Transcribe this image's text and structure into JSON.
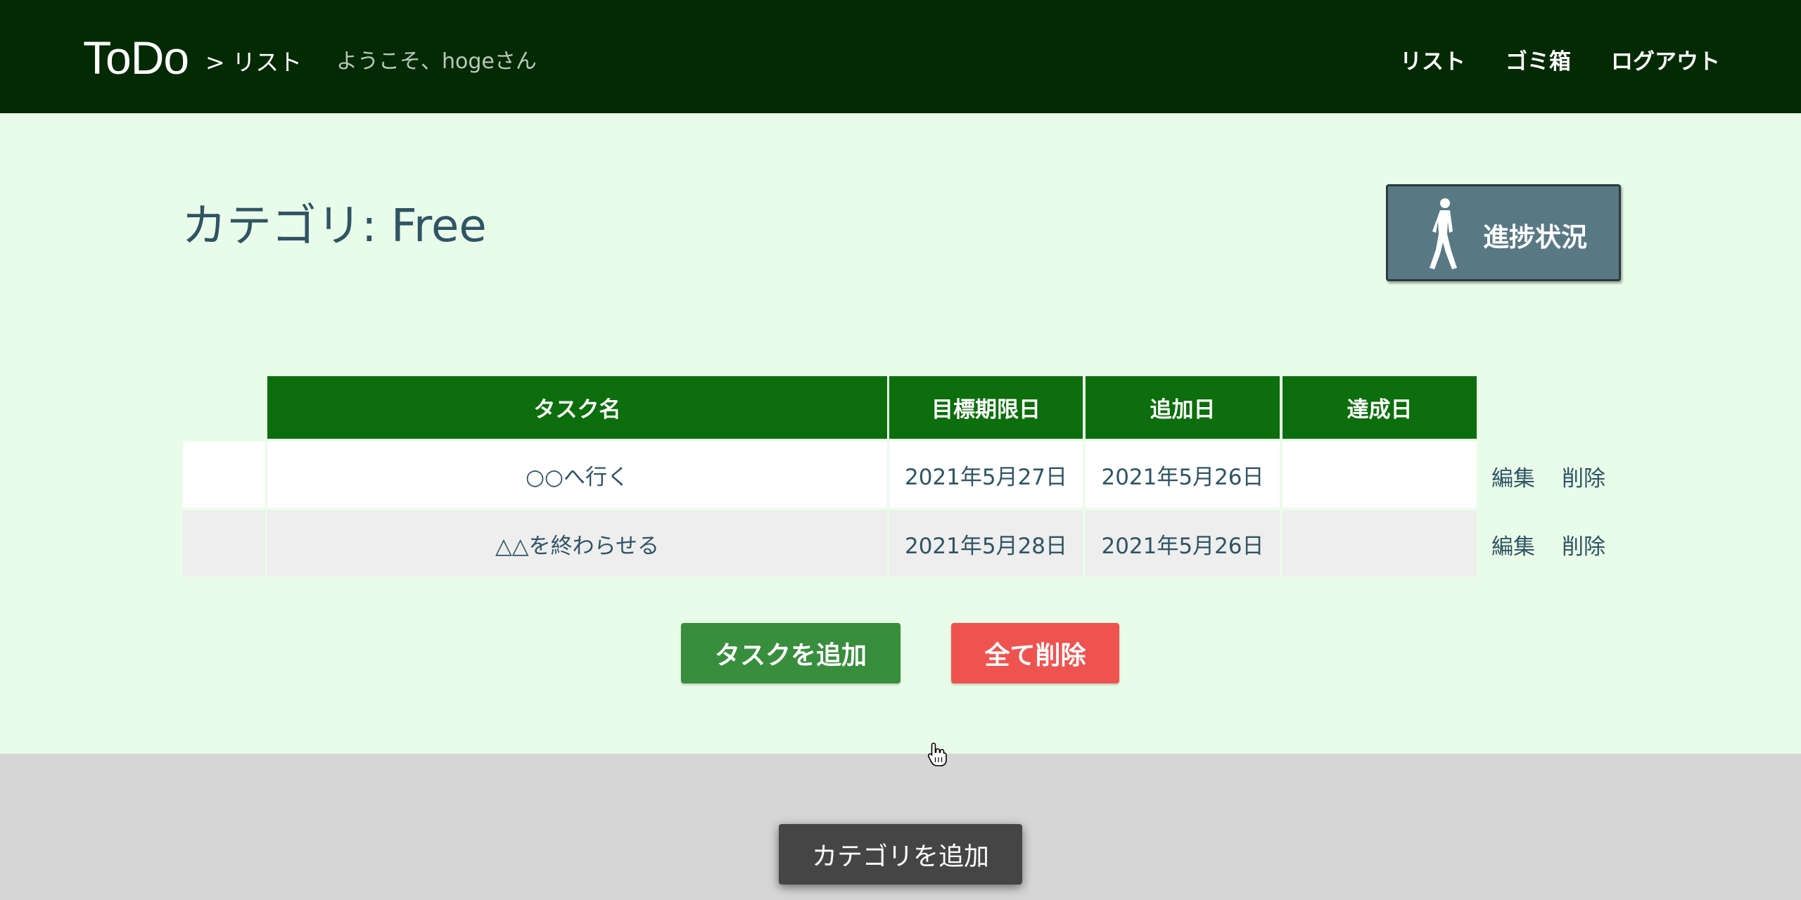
{
  "header": {
    "logo": "ToDo",
    "breadcrumb": "> リスト",
    "welcome": "ようこそ、hogeさん",
    "nav": {
      "list": "リスト",
      "trash": "ゴミ箱",
      "logout": "ログアウト"
    }
  },
  "page": {
    "title": "カテゴリ: Free",
    "progress_button": "進捗状況",
    "progress_icon": "walking-person-icon"
  },
  "table": {
    "columns": [
      "タスク名",
      "目標期限日",
      "追加日",
      "達成日"
    ],
    "rows": [
      {
        "name": "○○へ行く",
        "due": "2021年5月27日",
        "added": "2021年5月26日",
        "done": "",
        "edit": "編集",
        "delete": "削除"
      },
      {
        "name": "△△を終わらせる",
        "due": "2021年5月28日",
        "added": "2021年5月26日",
        "done": "",
        "edit": "編集",
        "delete": "削除"
      }
    ]
  },
  "actions": {
    "add_task": "タスクを追加",
    "delete_all": "全て削除",
    "add_category": "カテゴリを追加"
  },
  "colors": {
    "header_bg": "#032a03",
    "page_bg": "#e9fce9",
    "table_header": "#0c6e0c",
    "add_task": "#388e3c",
    "delete_all": "#ef5350",
    "add_category": "#454545"
  }
}
